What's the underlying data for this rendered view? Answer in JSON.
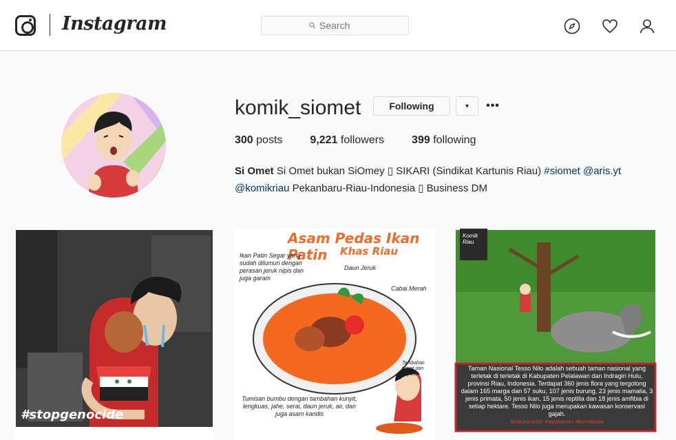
{
  "header": {
    "brand": "Instagram",
    "search_placeholder": "Search",
    "icons": [
      "compass-icon",
      "heart-icon",
      "person-icon"
    ]
  },
  "profile": {
    "username": "komik_siomet",
    "following_button": "Following",
    "dropdown_glyph": "▾",
    "more_glyph": "•••",
    "stats": {
      "posts_count": "300",
      "posts_label": "posts",
      "followers_count": "9,221",
      "followers_label": "followers",
      "following_count": "399",
      "following_label": "following"
    },
    "bio": {
      "name": "Si Omet",
      "line1": " Si Omet bukan SiOmey ▯ SIKARI (Sindikat Kartunis Riau) ",
      "tag1": "#siomet",
      "mention1": "@aris.yt",
      "mention2": "@komikriau",
      "line2": " Pekanbaru-Riau-Indonesia ▯ Business DM"
    }
  },
  "posts": [
    {
      "caption": "#stopgenocide"
    },
    {
      "title": "Asam Pedas Ikan Patin",
      "subtitle": "Khas Riau",
      "notes": [
        "Ikan Patin Segar yang sudah dilumuri dengan perasan jeruk nipis dan juga garam",
        "Daun Jeruk",
        "Cabai Merah",
        "Tambahan tomat dan sayuran",
        "Tumisan bumbu dengan tambahan kunyit, lengkuas, jahe, serai, daun jeruk, air, dan juga asam kandis"
      ]
    },
    {
      "badge": "Komik Riau",
      "text": "Taman Nasional Tesso Nilo adalah sebuah taman nasional yang terletak di terletak di Kabupaten Pelalawan dan Indragiri Hulu, provinsi Riau, Indonesia. Terdapat 360 jenis flora yang tergolong dalam 165 marga dan 57 suku, 107 jenis burung, 23 jenis mamalia, 3 jenis primata, 50 jenis ikan, 15 jenis reptilia dan 18 jenis amfibia di setiap hektare. Tesso Nilo juga merupakan kawasan konservasi gajah.",
      "tags": "#riauincomic #ayokeriau #komikriau"
    }
  ],
  "colors": {
    "text": "#262626",
    "border": "#dbdbdb",
    "background": "#fafafa",
    "link": "#003569"
  }
}
